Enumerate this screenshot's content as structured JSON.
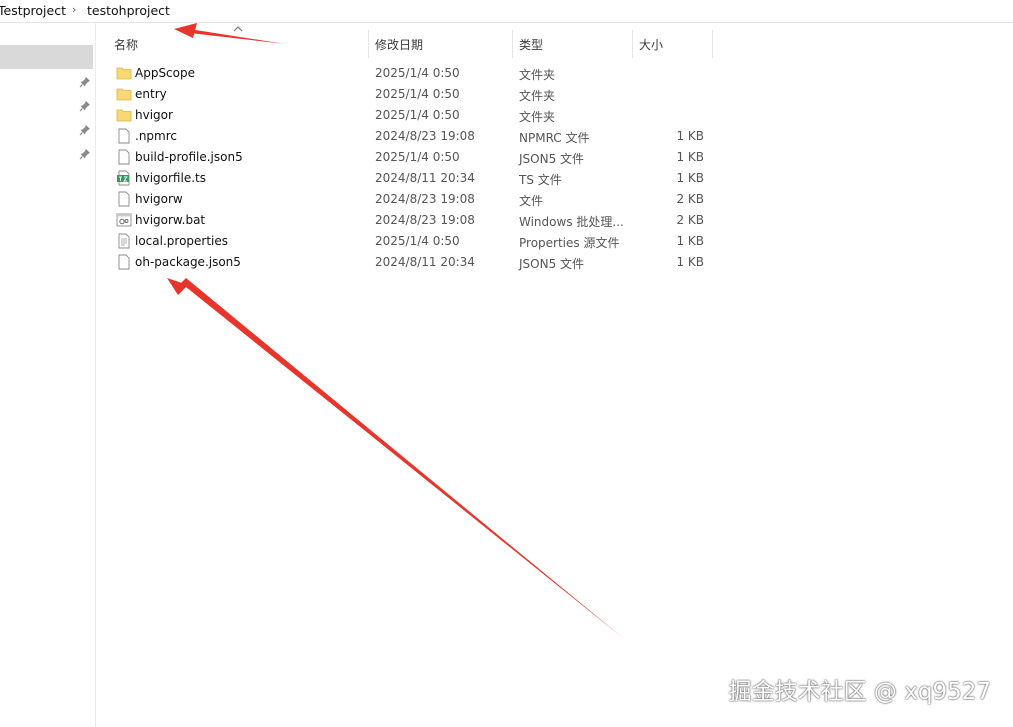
{
  "breadcrumb": [
    "Testproject",
    "testohproject"
  ],
  "columns": {
    "name": "名称",
    "date": "修改日期",
    "type": "类型",
    "size": "大小"
  },
  "files": [
    {
      "name": "AppScope",
      "date": "2025/1/4 0:50",
      "type": "文件夹",
      "size": "",
      "icon": "folder-icon"
    },
    {
      "name": "entry",
      "date": "2025/1/4 0:50",
      "type": "文件夹",
      "size": "",
      "icon": "folder-icon"
    },
    {
      "name": "hvigor",
      "date": "2025/1/4 0:50",
      "type": "文件夹",
      "size": "",
      "icon": "folder-icon"
    },
    {
      "name": ".npmrc",
      "date": "2024/8/23 19:08",
      "type": "NPMRC 文件",
      "size": "1 KB",
      "icon": "file-icon"
    },
    {
      "name": "build-profile.json5",
      "date": "2025/1/4 0:50",
      "type": "JSON5 文件",
      "size": "1 KB",
      "icon": "file-icon"
    },
    {
      "name": "hvigorfile.ts",
      "date": "2024/8/11 20:34",
      "type": "TS 文件",
      "size": "1 KB",
      "icon": "ts-file-icon"
    },
    {
      "name": "hvigorw",
      "date": "2024/8/23 19:08",
      "type": "文件",
      "size": "2 KB",
      "icon": "file-icon"
    },
    {
      "name": "hvigorw.bat",
      "date": "2024/8/23 19:08",
      "type": "Windows 批处理...",
      "size": "2 KB",
      "icon": "batch-file-icon"
    },
    {
      "name": "local.properties",
      "date": "2025/1/4 0:50",
      "type": "Properties 源文件",
      "size": "1 KB",
      "icon": "properties-file-icon"
    },
    {
      "name": "oh-package.json5",
      "date": "2024/8/11 20:34",
      "type": "JSON5 文件",
      "size": "1 KB",
      "icon": "file-icon"
    }
  ],
  "watermark": "掘金技术社区 @ xq9527",
  "colors": {
    "folder": "#f8d775",
    "arrow": "#e8352b",
    "nav_selected": "#d9d9d9"
  }
}
